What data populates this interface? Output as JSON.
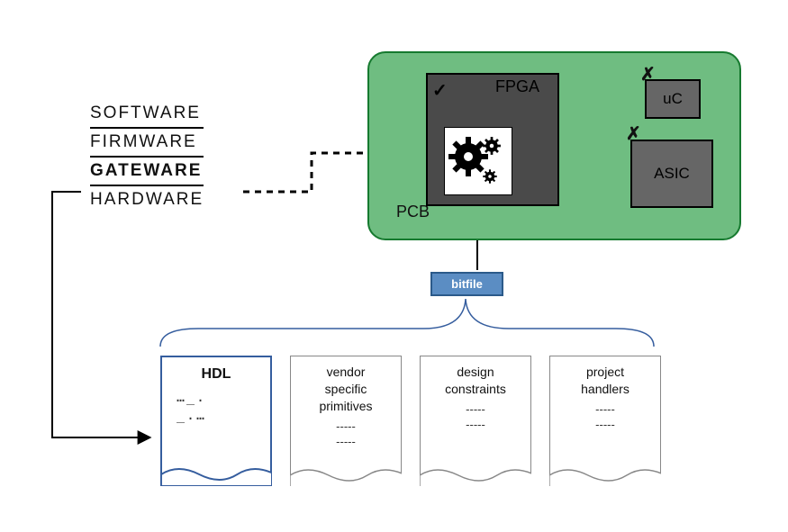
{
  "stack": {
    "l1": "SOFTWARE",
    "l2": "FIRMWARE",
    "l3": "GATEWARE",
    "l4": "HARDWARE"
  },
  "board": {
    "pcb_label": "PCB",
    "fpga_label": "FPGA",
    "uc_label": "uC",
    "asic_label": "ASIC",
    "check": "✓",
    "cross": "✗"
  },
  "bitfile_label": "bitfile",
  "cards": {
    "hdl": {
      "title": "HDL",
      "body": "…_.\n_.…"
    },
    "vendor": {
      "title": "vendor\nspecific\nprimitives",
      "body": "-----\n-----"
    },
    "design": {
      "title": "design\nconstraints",
      "body": "-----\n-----"
    },
    "project": {
      "title": "project\nhandlers",
      "body": "-----\n-----"
    }
  }
}
